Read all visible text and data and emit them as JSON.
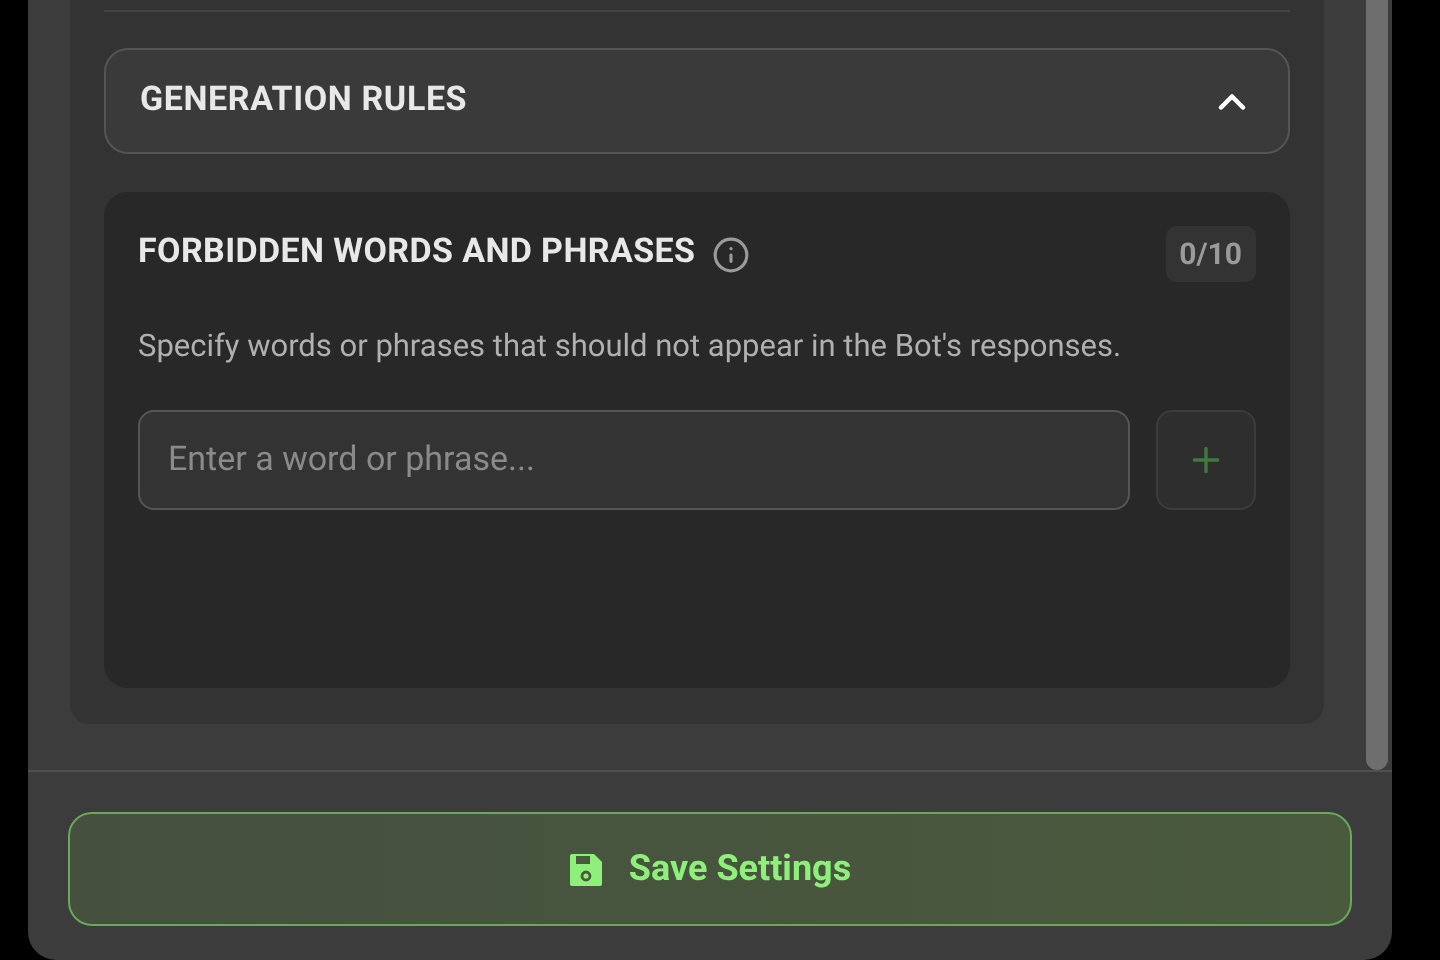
{
  "section": {
    "title": "GENERATION RULES",
    "expanded": true
  },
  "forbidden": {
    "title": "FORBIDDEN WORDS AND PHRASES",
    "count": "0/10",
    "description": "Specify words or phrases that should not appear in the Bot's responses.",
    "input": {
      "placeholder": "Enter a word or phrase..."
    },
    "add_disabled": true
  },
  "save_button": {
    "label": "Save Settings"
  }
}
